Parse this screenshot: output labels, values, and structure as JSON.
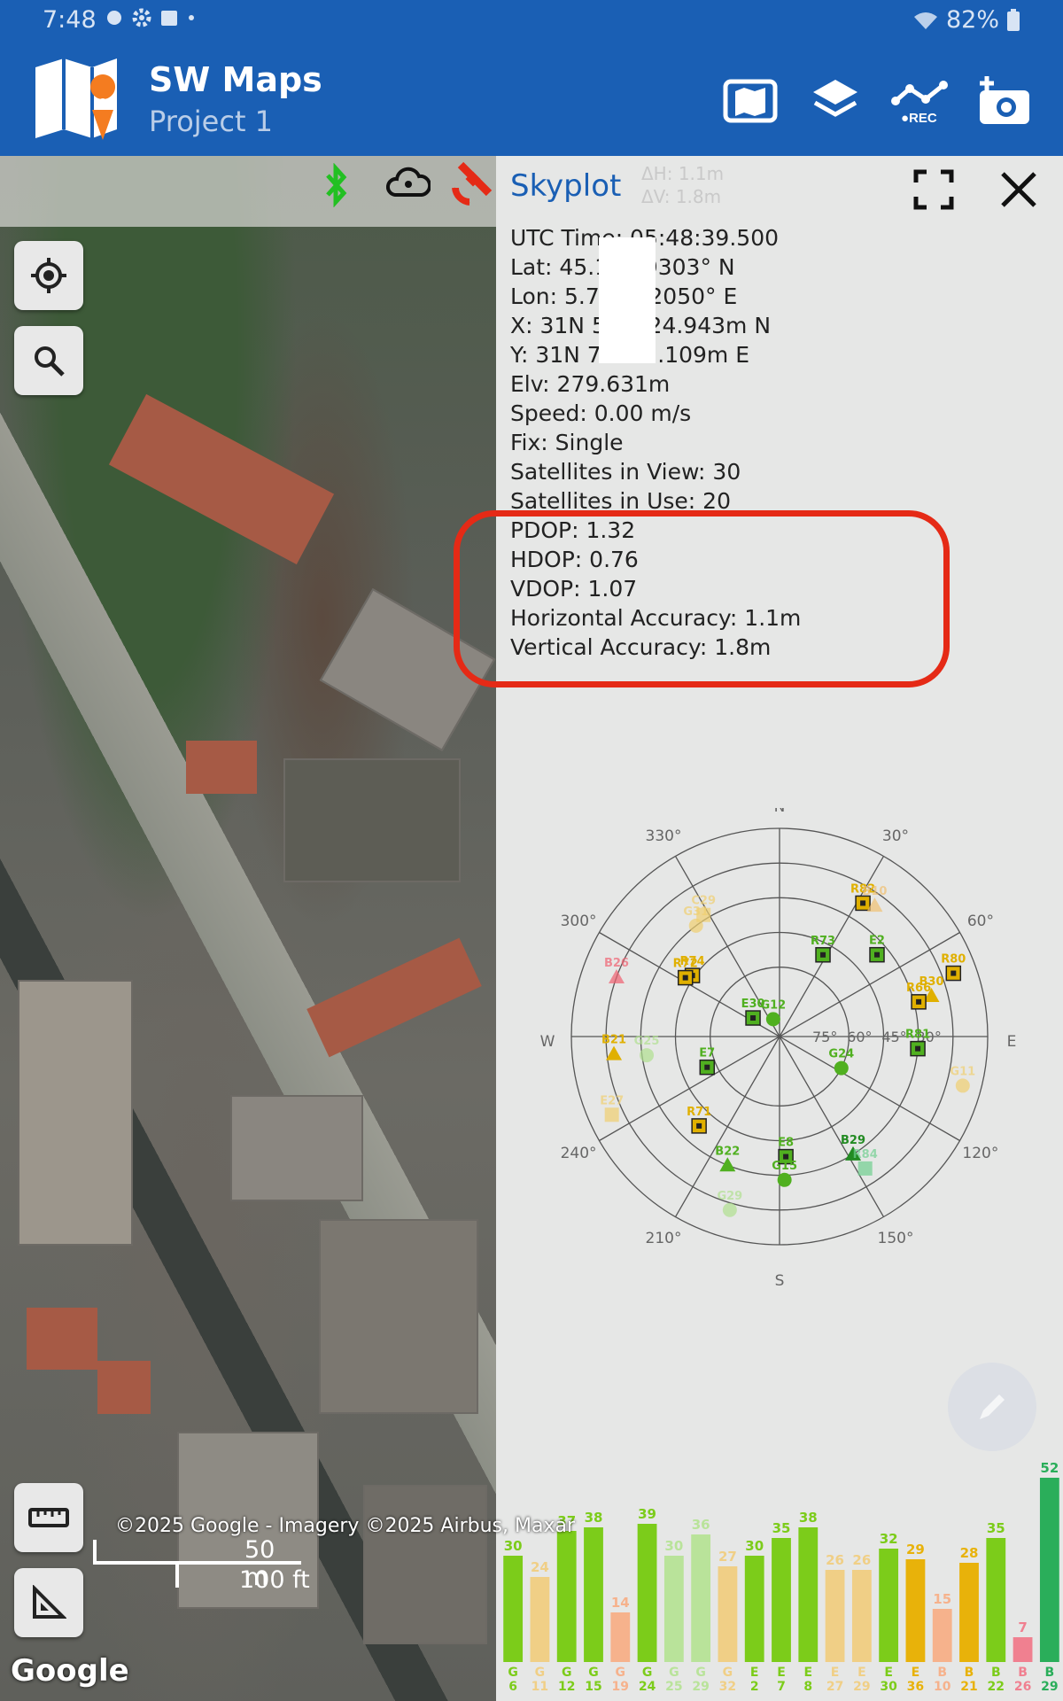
{
  "status_bar": {
    "time": "7:48",
    "battery": "82%"
  },
  "app": {
    "title": "SW Maps",
    "subtitle": "Project 1"
  },
  "map": {
    "scale_m": "50 m",
    "scale_ft": "100 ft",
    "google": "Google",
    "copyright": "©2025 Google - Imagery ©2025 Airbus, Maxar"
  },
  "panel": {
    "title": "Skyplot",
    "ghost_dh": "ΔH: 1.1m",
    "ghost_dv": "ΔV: 1.8m",
    "utc": "UTC Time: 05:48:39.500",
    "lat": "Lat: 45.1     9303° N",
    "lon": "Lon: 5.73     2050° E",
    "x": "X: 31N 5      24.943m N",
    "y": "Y: 31N 7      1.109m E",
    "elv": "Elv: 279.631m",
    "speed": "Speed: 0.00 m/s",
    "fix": "Fix: Single",
    "sats_view": "Satellites in View: 30",
    "sats_use": "Satellites in Use: 20",
    "pdop": "PDOP: 1.32",
    "hdop": "HDOP: 0.76",
    "vdop": "VDOP: 1.07",
    "hacc": "Horizontal Accuracy: 1.1m",
    "vacc": "Vertical Accuracy: 1.8m"
  },
  "skyplot": {
    "directions": [
      "N",
      "E",
      "S",
      "W"
    ],
    "azimuth_labels": [
      "30°",
      "60°",
      "120°",
      "150°",
      "210°",
      "240°",
      "300°",
      "330°"
    ],
    "elevation_labels": [
      "75°",
      "60°",
      "45°",
      "30°"
    ],
    "satellites": [
      {
        "id": "R82",
        "az": 32,
        "el": 22,
        "shape": "square",
        "color": "#e0b000",
        "used": true
      },
      {
        "id": "B10",
        "az": 36,
        "el": 20,
        "shape": "triangle",
        "color": "#f0c070",
        "used": false
      },
      {
        "id": "C29",
        "az": 328,
        "el": 28,
        "shape": "square",
        "color": "#f0d070",
        "used": false
      },
      {
        "id": "G31",
        "az": 323,
        "el": 30,
        "shape": "circle",
        "color": "#f0d070",
        "used": false
      },
      {
        "id": "R73",
        "az": 28,
        "el": 50,
        "shape": "square",
        "color": "#50b020",
        "used": true
      },
      {
        "id": "E2",
        "az": 50,
        "el": 35,
        "shape": "square",
        "color": "#50b020",
        "used": true
      },
      {
        "id": "R80",
        "az": 70,
        "el": 10,
        "shape": "square",
        "color": "#e0b000",
        "used": true
      },
      {
        "id": "B30",
        "az": 75,
        "el": 22,
        "shape": "triangle",
        "color": "#e0b000",
        "used": true
      },
      {
        "id": "R74",
        "az": 305,
        "el": 44,
        "shape": "square",
        "color": "#e0b000",
        "used": true
      },
      {
        "id": "R72",
        "az": 302,
        "el": 42,
        "shape": "square",
        "color": "#e0b000",
        "used": true
      },
      {
        "id": "B26",
        "az": 290,
        "el": 15,
        "shape": "triangle",
        "color": "#f06070",
        "used": false
      },
      {
        "id": "G12",
        "az": 340,
        "el": 82,
        "shape": "circle",
        "color": "#50b020",
        "used": true
      },
      {
        "id": "E30",
        "az": 305,
        "el": 76,
        "shape": "square",
        "color": "#50b020",
        "used": true
      },
      {
        "id": "R66",
        "az": 76,
        "el": 28,
        "shape": "square",
        "color": "#e0b000",
        "used": true
      },
      {
        "id": "R81",
        "az": 95,
        "el": 30,
        "shape": "square",
        "color": "#50b020",
        "used": true
      },
      {
        "id": "B21",
        "az": 264,
        "el": 18,
        "shape": "triangle",
        "color": "#e0b000",
        "used": true
      },
      {
        "id": "G25",
        "az": 262,
        "el": 32,
        "shape": "circle",
        "color": "#b0e090",
        "used": false
      },
      {
        "id": "E7",
        "az": 247,
        "el": 56,
        "shape": "square",
        "color": "#50b020",
        "used": true
      },
      {
        "id": "E27",
        "az": 245,
        "el": 10,
        "shape": "square",
        "color": "#f0d070",
        "used": false
      },
      {
        "id": "G24",
        "az": 117,
        "el": 60,
        "shape": "circle",
        "color": "#50b020",
        "used": true
      },
      {
        "id": "G11",
        "az": 105,
        "el": 8,
        "shape": "circle",
        "color": "#f0d070",
        "used": false
      },
      {
        "id": "R71",
        "az": 222,
        "el": 38,
        "shape": "square",
        "color": "#e0b000",
        "used": true
      },
      {
        "id": "B29",
        "az": 148,
        "el": 30,
        "shape": "triangle",
        "color": "#228b22",
        "used": true
      },
      {
        "id": "R84",
        "az": 147,
        "el": 22,
        "shape": "square",
        "color": "#70d090",
        "used": false
      },
      {
        "id": "B22",
        "az": 202,
        "el": 30,
        "shape": "triangle",
        "color": "#50b020",
        "used": true
      },
      {
        "id": "G29",
        "az": 196,
        "el": 12,
        "shape": "circle",
        "color": "#b0e090",
        "used": false
      },
      {
        "id": "E8",
        "az": 177,
        "el": 38,
        "shape": "square",
        "color": "#50b020",
        "used": true
      },
      {
        "id": "G15",
        "az": 178,
        "el": 28,
        "shape": "circle",
        "color": "#50b020",
        "used": true
      }
    ]
  },
  "signal_bars": [
    {
      "label": "G\n6",
      "value": 30,
      "color": "#7ccc1a"
    },
    {
      "label": "G\n11",
      "value": 24,
      "color": "#f0cf86"
    },
    {
      "label": "G\n12",
      "value": 37,
      "color": "#7ccc1a"
    },
    {
      "label": "G\n15",
      "value": 38,
      "color": "#7ccc1a"
    },
    {
      "label": "G\n19",
      "value": 14,
      "color": "#f6b28c"
    },
    {
      "label": "G\n24",
      "value": 39,
      "color": "#7ccc1a"
    },
    {
      "label": "G\n25",
      "value": 30,
      "color": "#b9e39a"
    },
    {
      "label": "G\n29",
      "value": 36,
      "color": "#b9e39a"
    },
    {
      "label": "G\n32",
      "value": 27,
      "color": "#f0cf86"
    },
    {
      "label": "E\n2",
      "value": 30,
      "color": "#7ccc1a"
    },
    {
      "label": "E\n7",
      "value": 35,
      "color": "#7ccc1a"
    },
    {
      "label": "E\n8",
      "value": 38,
      "color": "#7ccc1a"
    },
    {
      "label": "E\n27",
      "value": 26,
      "color": "#f0cf86"
    },
    {
      "label": "E\n29",
      "value": 26,
      "color": "#f0cf86"
    },
    {
      "label": "E\n30",
      "value": 32,
      "color": "#7ccc1a"
    },
    {
      "label": "E\n36",
      "value": 29,
      "color": "#e8b20a"
    },
    {
      "label": "B\n10",
      "value": 15,
      "color": "#f6b28c"
    },
    {
      "label": "B\n21",
      "value": 28,
      "color": "#e8b20a"
    },
    {
      "label": "B\n22",
      "value": 35,
      "color": "#7ccc1a"
    },
    {
      "label": "B\n26",
      "value": 7,
      "color": "#f08090"
    },
    {
      "label": "B\n29",
      "value": 52,
      "color": "#2aae5a"
    }
  ]
}
